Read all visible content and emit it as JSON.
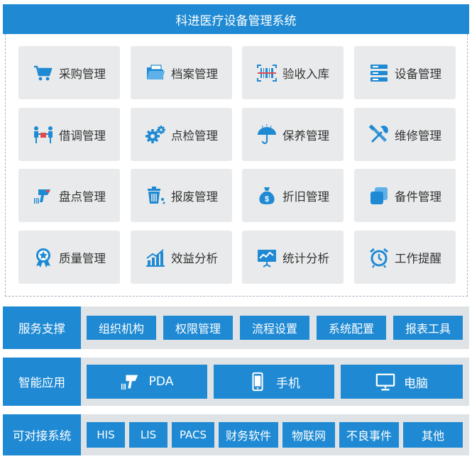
{
  "title": "科进医疗设备管理系统",
  "modules": [
    {
      "label": "采购管理",
      "icon": "shopping-cart-icon"
    },
    {
      "label": "档案管理",
      "icon": "folder-icon"
    },
    {
      "label": "验收入库",
      "icon": "barcode-scan-icon"
    },
    {
      "label": "设备管理",
      "icon": "server-stack-icon"
    },
    {
      "label": "借调管理",
      "icon": "handover-icon"
    },
    {
      "label": "点检管理",
      "icon": "gears-icon"
    },
    {
      "label": "保养管理",
      "icon": "umbrella-icon"
    },
    {
      "label": "维修管理",
      "icon": "tools-icon"
    },
    {
      "label": "盘点管理",
      "icon": "barcode-scanner-icon"
    },
    {
      "label": "报废管理",
      "icon": "trash-bin-icon"
    },
    {
      "label": "折旧管理",
      "icon": "money-bag-icon"
    },
    {
      "label": "备件管理",
      "icon": "copy-icon"
    },
    {
      "label": "质量管理",
      "icon": "medal-icon"
    },
    {
      "label": "效益分析",
      "icon": "bar-chart-icon"
    },
    {
      "label": "统计分析",
      "icon": "presentation-chart-icon"
    },
    {
      "label": "工作提醒",
      "icon": "alarm-clock-icon"
    }
  ],
  "service_support": {
    "label": "服务支撑",
    "items": [
      "组织机构",
      "权限管理",
      "流程设置",
      "系统配置",
      "报表工具"
    ]
  },
  "smart_apps": {
    "label": "智能应用",
    "items": [
      {
        "label": "PDA",
        "icon": "barcode-scanner-icon"
      },
      {
        "label": "手机",
        "icon": "mobile-phone-icon"
      },
      {
        "label": "电脑",
        "icon": "monitor-icon"
      }
    ]
  },
  "integrations": {
    "label": "可对接系统",
    "items": [
      "HIS",
      "LIS",
      "PACS",
      "财务软件",
      "物联网",
      "不良事件",
      "其他"
    ]
  },
  "colors": {
    "primary": "#1f8ad3",
    "tile_bg": "#e9eaeb",
    "band_bg": "#dfe3e6"
  }
}
